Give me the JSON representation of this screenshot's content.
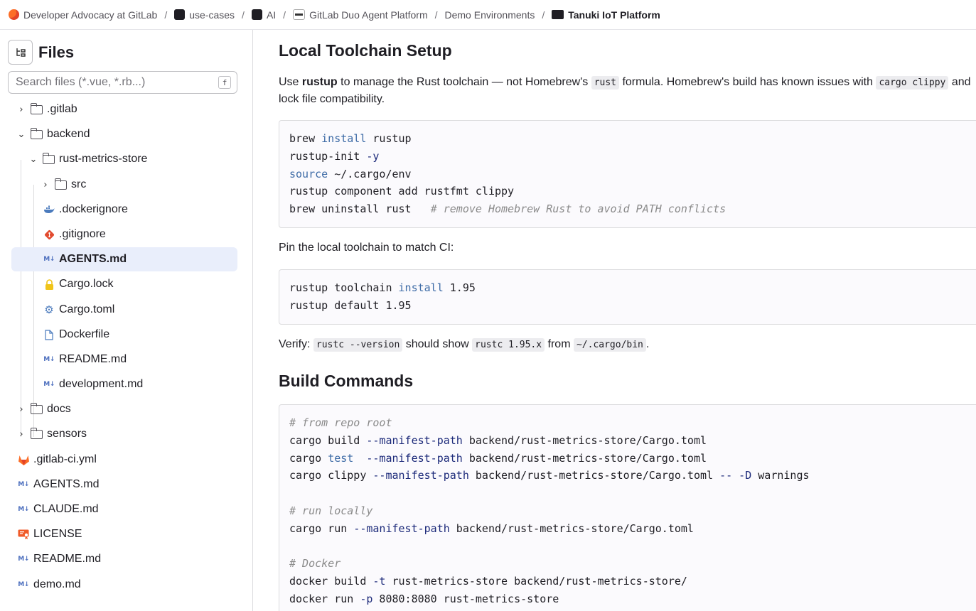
{
  "breadcrumb": [
    {
      "label": "Developer Advocacy at GitLab",
      "icon": "group-avatar-icon"
    },
    {
      "label": "use-cases",
      "icon": "subgroup-avatar-icon"
    },
    {
      "label": "AI",
      "icon": "subgroup-avatar-icon"
    },
    {
      "label": "GitLab Duo Agent Platform",
      "icon": "subgroup-avatar-icon"
    },
    {
      "label": "Demo Environments"
    },
    {
      "label": "Tanuki IoT Platform",
      "icon": "project-avatar-icon"
    }
  ],
  "sidebar": {
    "title": "Files",
    "search_placeholder": "Search files (*.vue, *.rb...)",
    "search_shortcut": "f",
    "tree": [
      {
        "label": ".gitlab",
        "type": "folder",
        "expanded": false
      },
      {
        "label": "backend",
        "type": "folder",
        "expanded": true
      },
      {
        "label": "rust-metrics-store",
        "type": "folder",
        "expanded": true
      },
      {
        "label": "src",
        "type": "folder",
        "expanded": false
      },
      {
        "label": ".dockerignore",
        "type": "file",
        "icon": "docker-icon"
      },
      {
        "label": ".gitignore",
        "type": "file",
        "icon": "git-icon"
      },
      {
        "label": "AGENTS.md",
        "type": "file",
        "icon": "markdown-icon",
        "selected": true
      },
      {
        "label": "Cargo.lock",
        "type": "file",
        "icon": "lock-icon"
      },
      {
        "label": "Cargo.toml",
        "type": "file",
        "icon": "gear-icon"
      },
      {
        "label": "Dockerfile",
        "type": "file",
        "icon": "file-icon"
      },
      {
        "label": "README.md",
        "type": "file",
        "icon": "markdown-icon"
      },
      {
        "label": "development.md",
        "type": "file",
        "icon": "markdown-icon"
      },
      {
        "label": "docs",
        "type": "folder",
        "expanded": false
      },
      {
        "label": "sensors",
        "type": "folder",
        "expanded": false
      },
      {
        "label": ".gitlab-ci.yml",
        "type": "file",
        "icon": "gitlab-icon"
      },
      {
        "label": "AGENTS.md",
        "type": "file",
        "icon": "markdown-icon"
      },
      {
        "label": "CLAUDE.md",
        "type": "file",
        "icon": "markdown-icon"
      },
      {
        "label": "LICENSE",
        "type": "file",
        "icon": "license-icon"
      },
      {
        "label": "README.md",
        "type": "file",
        "icon": "markdown-icon"
      },
      {
        "label": "demo.md",
        "type": "file",
        "icon": "markdown-icon"
      }
    ]
  },
  "content": {
    "heading1": "Local Toolchain Setup",
    "para1": {
      "t1": "Use ",
      "b1": "rustup",
      "t2": " to manage the Rust toolchain — not Homebrew's ",
      "c1": "rust",
      "t3": " formula. Homebrew's build has known issues with ",
      "c2": "cargo clippy",
      "t4": " and lock file compatibility."
    },
    "code1": [
      "brew install rustup",
      "rustup-init -y",
      "source ~/.cargo/env",
      "rustup component add rustfmt clippy",
      "brew uninstall rust   # remove Homebrew Rust to avoid PATH conflicts"
    ],
    "para2": "Pin the local toolchain to match CI:",
    "code2": [
      "rustup toolchain install 1.95",
      "rustup default 1.95"
    ],
    "para3": {
      "t1": "Verify: ",
      "c1": "rustc --version",
      "t2": " should show ",
      "c2": "rustc 1.95.x",
      "t3": " from ",
      "c3": "~/.cargo/bin",
      "t4": "."
    },
    "heading2": "Build Commands",
    "code3": [
      "# from repo root",
      "cargo build --manifest-path backend/rust-metrics-store/Cargo.toml",
      "cargo test  --manifest-path backend/rust-metrics-store/Cargo.toml",
      "cargo clippy --manifest-path backend/rust-metrics-store/Cargo.toml -- -D warnings",
      "",
      "# run locally",
      "cargo run --manifest-path backend/rust-metrics-store/Cargo.toml",
      "",
      "# Docker",
      "docker build -t rust-metrics-store backend/rust-metrics-store/",
      "docker run -p 8080:8080 rust-metrics-store"
    ]
  },
  "colors": {
    "selected_row": "#e9eefb",
    "keyword": "#3d6ba6",
    "flag": "#1c2a7a",
    "comment": "#8a8a8a"
  }
}
